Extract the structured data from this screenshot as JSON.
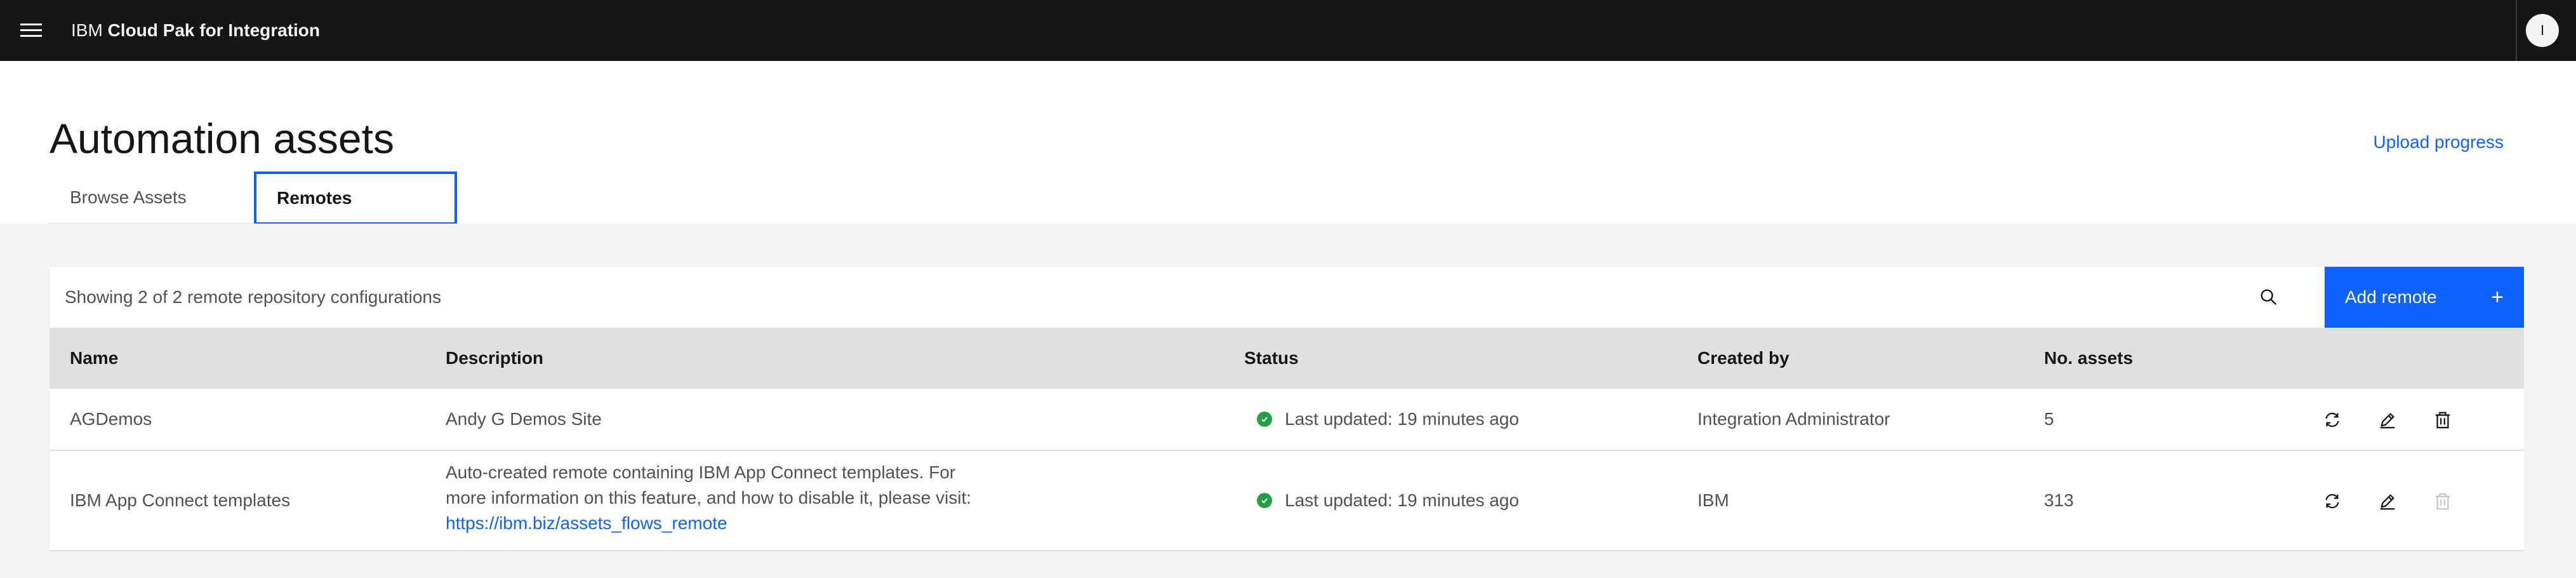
{
  "header": {
    "brand_prefix": "IBM",
    "brand_product": "Cloud Pak for Integration",
    "avatar_initial": "I"
  },
  "page": {
    "title": "Automation assets",
    "upload_link": "Upload progress"
  },
  "tabs": [
    {
      "label": "Browse Assets",
      "active": false
    },
    {
      "label": "Remotes",
      "active": true
    }
  ],
  "toolbar": {
    "count_text": "Showing 2 of 2 remote repository configurations",
    "add_label": "Add remote",
    "add_icon": "+"
  },
  "table": {
    "columns": [
      "Name",
      "Description",
      "Status",
      "Created by",
      "No. assets"
    ],
    "rows": [
      {
        "name": "AGDemos",
        "description": "Andy G Demos Site",
        "status": "Last updated: 19 minutes ago",
        "created_by": "Integration Administrator",
        "assets": "5",
        "delete_enabled": true
      },
      {
        "name": "IBM App Connect templates",
        "description": "Auto-created remote containing IBM App Connect templates. For more information on this feature, and how to disable it, please visit:",
        "description_link": "https://ibm.biz/assets_flows_remote",
        "status": "Last updated: 19 minutes ago",
        "created_by": "IBM",
        "assets": "313",
        "delete_enabled": false
      }
    ]
  },
  "colors": {
    "header_bg": "#161616",
    "accent": "#0f62fe",
    "success": "#24a148",
    "content_bg": "#f4f4f4",
    "table_header_bg": "#e0e0e0"
  },
  "icons": {
    "menu": "hamburger-menu-icon",
    "search": "search-icon",
    "sync": "sync-icon",
    "edit": "edit-icon",
    "delete": "trash-icon",
    "status": "checkmark-filled-icon"
  }
}
